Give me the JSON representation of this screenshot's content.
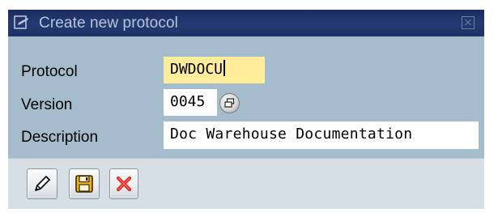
{
  "dialog": {
    "title": "Create new protocol",
    "title_icon": "create-document-icon",
    "close_icon": "close-icon"
  },
  "fields": {
    "protocol": {
      "label": "Protocol",
      "value": "DWDOCU"
    },
    "version": {
      "label": "Version",
      "value": "0045",
      "button_icon": "possible-entries-icon"
    },
    "description": {
      "label": "Description",
      "value": "Doc Warehouse Documentation"
    }
  },
  "toolbar": {
    "buttons": [
      {
        "icon": "pencil-icon"
      },
      {
        "icon": "save-icon"
      },
      {
        "icon": "cancel-icon"
      }
    ]
  },
  "colors": {
    "titlebar": "#1e3164",
    "title_text": "#b7c4d8",
    "content_bg": "#a4bccc",
    "active_field": "#ffed9c",
    "toolbar_bg": "#d7dfe6",
    "cancel_red": "#d9231b"
  }
}
